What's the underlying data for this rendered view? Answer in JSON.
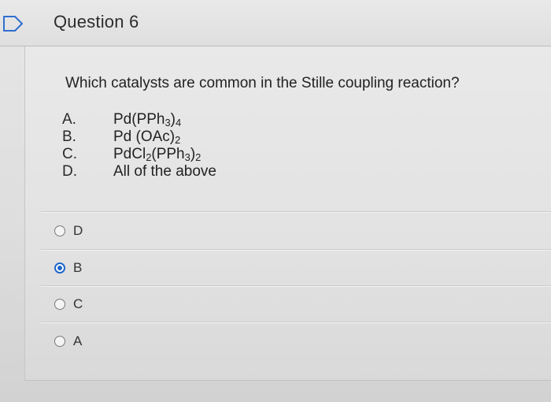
{
  "header": {
    "title": "Question 6"
  },
  "question": {
    "text": "Which catalysts are common in the Stille coupling reaction?",
    "options": [
      {
        "letter": "A.",
        "text_parts": [
          "Pd(PPh",
          "3",
          ")",
          "4",
          ""
        ]
      },
      {
        "letter": "B.",
        "text_parts": [
          "Pd (OAc)",
          "2",
          "",
          "",
          ""
        ]
      },
      {
        "letter": "C.",
        "text_parts": [
          "PdCl",
          "2",
          "(PPh",
          "3",
          ")2"
        ]
      },
      {
        "letter": "D.",
        "text_parts": [
          "All of the above",
          "",
          "",
          "",
          ""
        ]
      }
    ]
  },
  "answers": [
    {
      "label": "D",
      "selected": false
    },
    {
      "label": "B",
      "selected": true
    },
    {
      "label": "C",
      "selected": false
    },
    {
      "label": "A",
      "selected": false
    }
  ],
  "colors": {
    "accent": "#1e67c8"
  }
}
